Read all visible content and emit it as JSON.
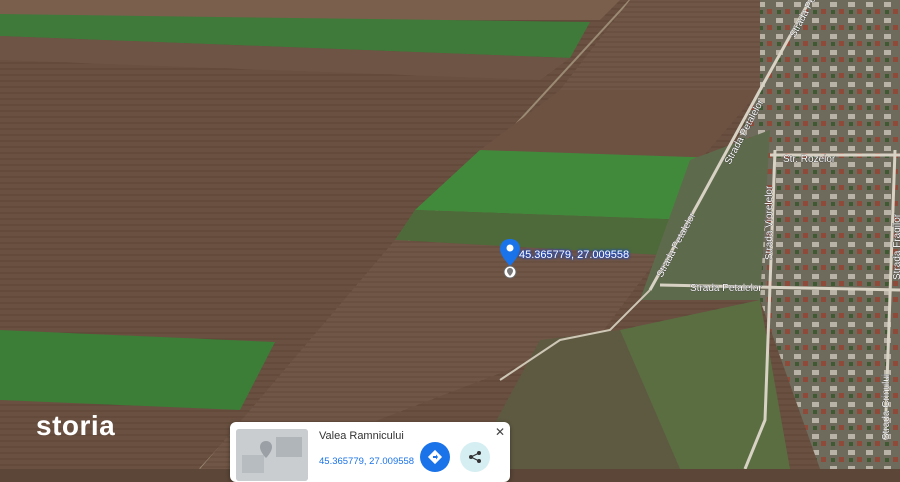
{
  "map": {
    "streets": [
      "Strada Petalelor",
      "Str. Rozelor",
      "Strada Viorelelor",
      "Strada Petalelor",
      "Strada Petalelor",
      "Strada Crinului",
      "Strada Fragilor"
    ],
    "pin_label": "45.365779, 27.009558"
  },
  "brand": {
    "logo": "storia"
  },
  "place_card": {
    "title": "Valea Ramnicului",
    "coordinates": "45.365779, 27.009558",
    "close": "✕",
    "directions_icon": "directions-icon",
    "share_icon": "share-icon"
  },
  "colors": {
    "pin": "#1a73e8",
    "field_green": "#3f7a3a",
    "field_brown": "#6b5141"
  }
}
